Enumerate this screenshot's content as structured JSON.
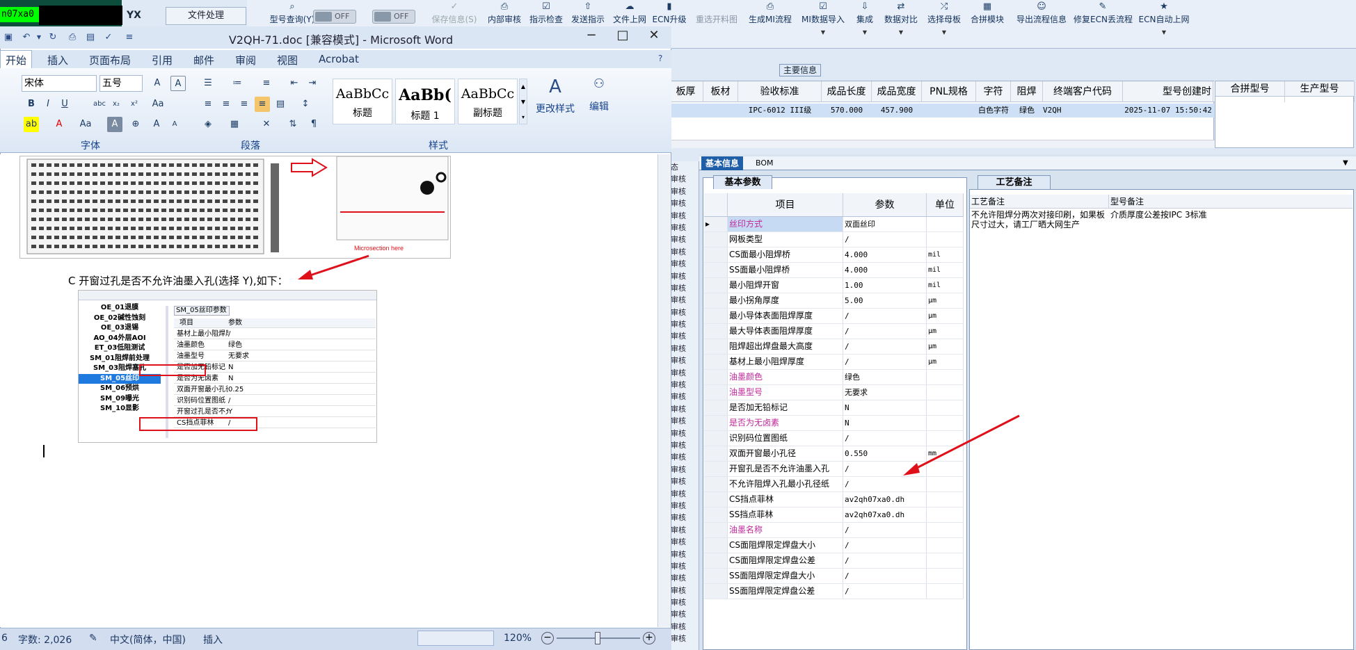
{
  "erp": {
    "user_code": "n07xa0",
    "app_tag": "YX",
    "file_menu": "文件处理",
    "toggles": [
      "OFF",
      "OFF"
    ],
    "toolbar": [
      {
        "label": "型号查询(Y)",
        "icon": "search-icon"
      },
      {
        "label": "保存信息(S)",
        "icon": "check-icon"
      },
      {
        "label": "内部审核",
        "icon": "print-icon"
      },
      {
        "label": "指示检查",
        "icon": "checklist-icon"
      },
      {
        "label": "发送指示",
        "icon": "upload-icon"
      },
      {
        "label": "文件上网",
        "icon": "cloud-icon"
      },
      {
        "label": "ECN升级",
        "icon": "bars-icon"
      },
      {
        "label": "重选开料图",
        "icon": ""
      },
      {
        "label": "生成MI流程",
        "icon": "print-icon"
      },
      {
        "label": "MI数据导入",
        "icon": "checklist-icon"
      },
      {
        "label": "集成",
        "icon": "download-icon"
      },
      {
        "label": "数据对比",
        "icon": "compare-icon"
      },
      {
        "label": "选择母板",
        "icon": "shuffle-icon"
      },
      {
        "label": "合拼模块",
        "icon": "grid-icon"
      },
      {
        "label": "导出流程信息",
        "icon": "smile-icon"
      },
      {
        "label": "修复ECN丢流程",
        "icon": "wrench-icon"
      },
      {
        "label": "ECN自动上网",
        "icon": "star-icon"
      }
    ],
    "main_info_title": "主要信息",
    "info_headers": [
      "板厚",
      "板材",
      "验收标准",
      "成品长度",
      "成品宽度",
      "PNL规格",
      "字符",
      "阻焊",
      "终端客户代码",
      "型号创建时"
    ],
    "info_row": [
      "",
      "",
      "IPC-6012 III级",
      "570.000",
      "457.900",
      "",
      "白色字符",
      "绿色",
      "V2QH",
      "2025-11-07 15:50:42"
    ],
    "merge_headers": [
      "合拼型号",
      "生产型号"
    ],
    "side_items": [
      "态",
      "审核",
      "审核",
      "审核",
      "审核",
      "审核",
      "审核",
      "审核",
      "审核",
      "审核",
      "审核",
      "审核",
      "审核",
      "审核",
      "审核",
      "审核",
      "审核",
      "审核",
      "审核",
      "审核",
      "审核",
      "审核",
      "审核",
      "审核",
      "审核",
      "审核",
      "审核",
      "审核",
      "审核",
      "审核",
      "审核",
      "审核",
      "审核",
      "审核",
      "审核",
      "审核",
      "审核",
      "审核",
      "审核",
      "审核"
    ],
    "bottom_tabs": [
      "基本信息",
      "BOM"
    ],
    "param_tab": "基本参数",
    "param_headers": [
      "项目",
      "参数",
      "单位"
    ],
    "params": [
      {
        "item": "丝印方式",
        "value": "双面丝印",
        "unit": "",
        "pink": true
      },
      {
        "item": "网板类型",
        "value": "/",
        "unit": "",
        "pink": false
      },
      {
        "item": "CS面最小阻焊桥",
        "value": "4.000",
        "unit": "mil",
        "pink": false
      },
      {
        "item": "SS面最小阻焊桥",
        "value": "4.000",
        "unit": "mil",
        "pink": false
      },
      {
        "item": "最小阻焊开窗",
        "value": "1.00",
        "unit": "mil",
        "pink": false
      },
      {
        "item": "最小拐角厚度",
        "value": "5.00",
        "unit": "μm",
        "pink": false
      },
      {
        "item": "最小导体表面阻焊厚度",
        "value": "/",
        "unit": "μm",
        "pink": false
      },
      {
        "item": "最大导体表面阻焊厚度",
        "value": "/",
        "unit": "μm",
        "pink": false
      },
      {
        "item": "阻焊超出焊盘最大高度",
        "value": "/",
        "unit": "μm",
        "pink": false
      },
      {
        "item": "基材上最小阻焊厚度",
        "value": "/",
        "unit": "μm",
        "pink": false
      },
      {
        "item": "油墨颜色",
        "value": "绿色",
        "unit": "",
        "pink": true
      },
      {
        "item": "油墨型号",
        "value": "无要求",
        "unit": "",
        "pink": true
      },
      {
        "item": "是否加无铅标记",
        "value": "N",
        "unit": "",
        "pink": false
      },
      {
        "item": "是否为无卤素",
        "value": "N",
        "unit": "",
        "pink": true
      },
      {
        "item": "识别码位置图纸",
        "value": "/",
        "unit": "",
        "pink": false
      },
      {
        "item": "双面开窗最小孔径",
        "value": "0.550",
        "unit": "mm",
        "pink": false
      },
      {
        "item": "开窗孔是否不允许油墨入孔",
        "value": "/",
        "unit": "",
        "pink": false
      },
      {
        "item": "不允许阻焊入孔最小孔径纸",
        "value": "/",
        "unit": "",
        "pink": false
      },
      {
        "item": "CS挡点菲林",
        "value": "av2qh07xa0.dh",
        "unit": "",
        "pink": false
      },
      {
        "item": "SS挡点菲林",
        "value": "av2qh07xa0.dh",
        "unit": "",
        "pink": false
      },
      {
        "item": "油墨名称",
        "value": "/",
        "unit": "",
        "pink": true
      },
      {
        "item": "CS面阻焊限定焊盘大小",
        "value": "/",
        "unit": "",
        "pink": false
      },
      {
        "item": "CS面阻焊限定焊盘公差",
        "value": "/",
        "unit": "",
        "pink": false
      },
      {
        "item": "SS面阻焊限定焊盘大小",
        "value": "/",
        "unit": "",
        "pink": false
      },
      {
        "item": "SS面阻焊限定焊盘公差",
        "value": "/",
        "unit": "",
        "pink": false
      }
    ],
    "craft_tab": "工艺备注",
    "craft_header1": "工艺备注",
    "craft_header2": "型号备注",
    "craft_note": "不允许阻焊分两次对接印刷，如果板尺寸过大，请工厂晒大网生产",
    "model_note": "介质厚度公差按IPC 3标准"
  },
  "word": {
    "title": "V2QH-71.doc [兼容模式] - Microsoft Word",
    "tabs": [
      "开始",
      "插入",
      "页面布局",
      "引用",
      "邮件",
      "审阅",
      "视图",
      "Acrobat"
    ],
    "font_name": "宋体",
    "font_size": "五号",
    "groups": [
      "字体",
      "段落",
      "样式"
    ],
    "styles": [
      {
        "sample": "AaBbCc",
        "name": "标题"
      },
      {
        "sample": "AaBb(",
        "name": "标题 1"
      },
      {
        "sample": "AaBbCc",
        "name": "副标题"
      }
    ],
    "change_styles": "更改样式",
    "edit": "编辑",
    "doc_caption": "C 开窗过孔是否不允许油墨入孔(选择 Y),如下：",
    "microsection_label": "Microsection here",
    "embedded_nav": [
      "OE_01退膜",
      "OE_02碱性蚀刻",
      "OE_03退锡",
      "AO_04外层AOI",
      "ET_03低阻测试",
      "SM_01阻焊前处理",
      "SM_03阻焊塞孔",
      "SM_05丝印",
      "SM_06预烘",
      "SM_09曝光",
      "SM_10显影"
    ],
    "embedded_tab": "SM_05丝印参数",
    "embedded_headers": [
      "项目",
      "参数"
    ],
    "embedded_rows": [
      [
        "基材上最小阻焊厚度μm",
        "/"
      ],
      [
        "油墨颜色",
        "绿色"
      ],
      [
        "油墨型号",
        "无要求"
      ],
      [
        "是否加无铅标记",
        "N"
      ],
      [
        "是否为无卤素",
        "N"
      ],
      [
        "双面开窗最小孔径mm",
        "0.25"
      ],
      [
        "识别码位置图纸",
        "/"
      ],
      [
        "开窗过孔是否不允许油墨入孔",
        "Y"
      ],
      [
        "CS挡点菲林",
        "/"
      ]
    ],
    "status": {
      "page": "6",
      "words": "字数: 2,026",
      "language": "中文(简体，中国)",
      "mode": "插入",
      "zoom": "120%"
    }
  },
  "colors": {
    "accent": "#15428b",
    "arrow": "#e0101a",
    "pink": "#c0289a",
    "highlight": "#00ff00"
  }
}
